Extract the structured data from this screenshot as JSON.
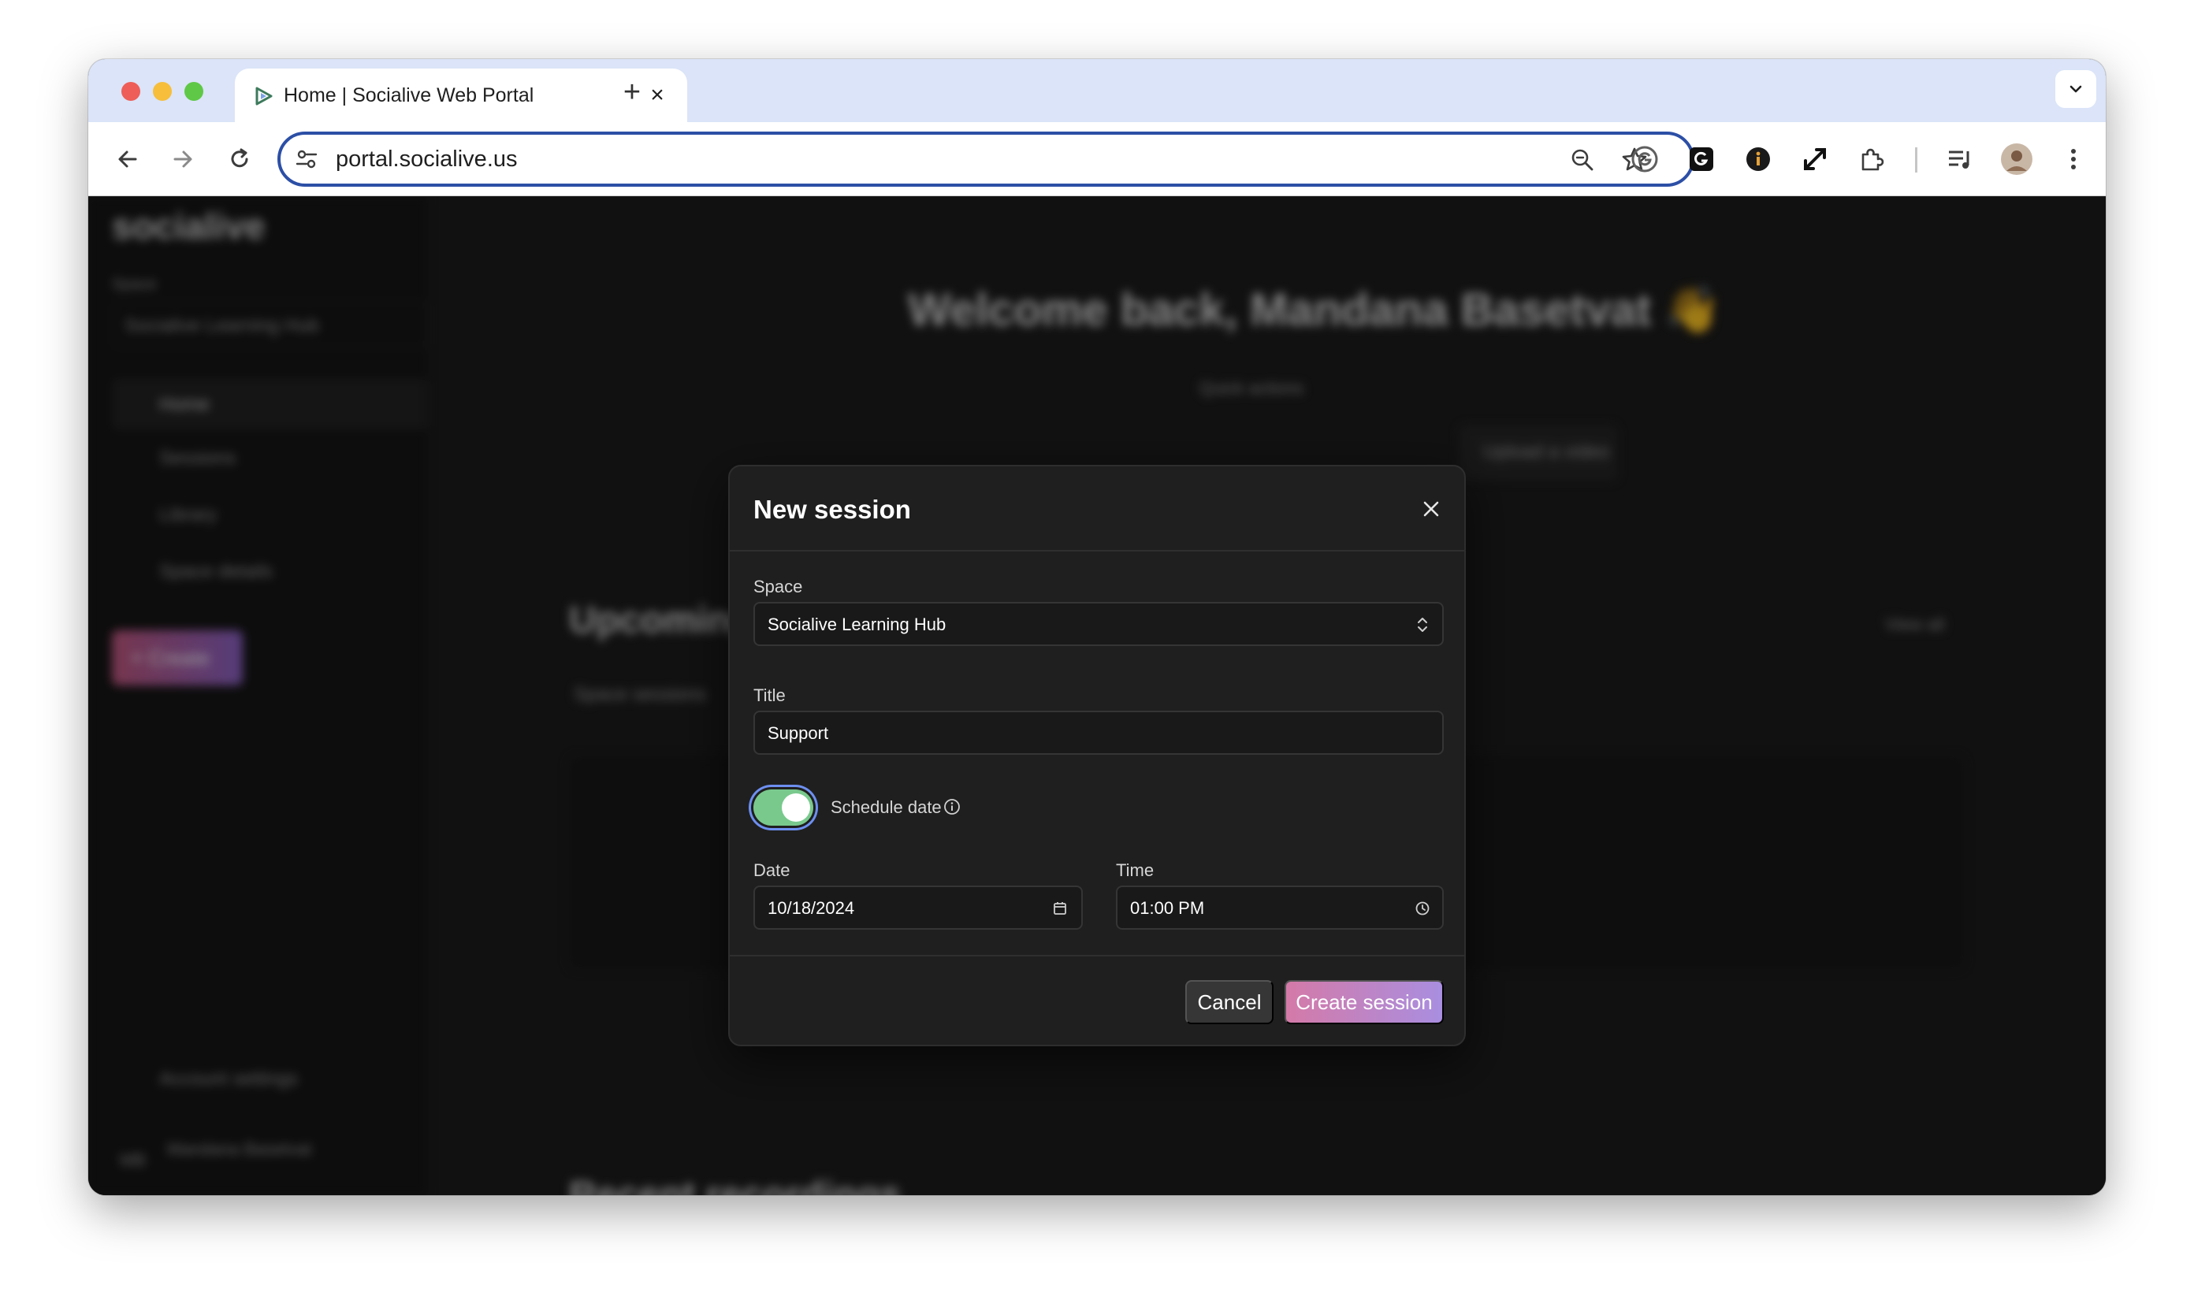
{
  "browser": {
    "tab_title": "Home | Socialive Web Portal",
    "url": "portal.socialive.us"
  },
  "background": {
    "logo": "socialive",
    "welcome": "Welcome back, Mandana Basetvat 👋",
    "quick_actions": "Quick actions",
    "upload_video": "Upload a video",
    "upcoming": "Upcoming",
    "view_all": "View all",
    "space_sessions": "Space sessions",
    "recent_recordings": "Recent recordings",
    "sidebar": {
      "space_label": "Space",
      "space_name": "Socialive Learning Hub",
      "items": [
        "Home",
        "Sessions",
        "Library",
        "Space details"
      ],
      "create": "+ Create",
      "account_settings": "Account settings",
      "user_name": "Mandana Basetvat",
      "user_initials": "MB"
    }
  },
  "modal": {
    "title": "New session",
    "space": {
      "label": "Space",
      "value": "Socialive Learning Hub"
    },
    "title_field": {
      "label": "Title",
      "value": "Support"
    },
    "schedule": {
      "label": "Schedule date",
      "enabled": true
    },
    "date": {
      "label": "Date",
      "value": "10/18/2024"
    },
    "time": {
      "label": "Time",
      "value": "01:00 PM"
    },
    "cancel_label": "Cancel",
    "create_label": "Create session"
  },
  "colors": {
    "accent_toggle": "#79c98d",
    "create_gradient_start": "#d47aa8",
    "create_gradient_end": "#a98ee0"
  }
}
